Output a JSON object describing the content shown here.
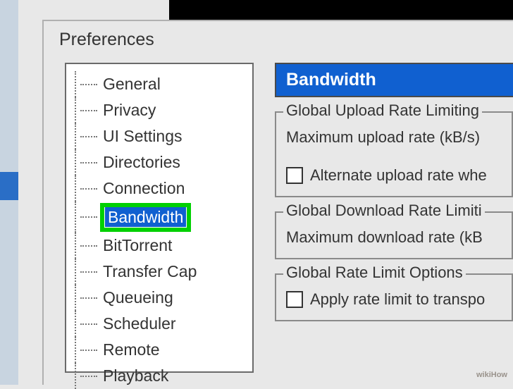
{
  "window": {
    "title": "Preferences"
  },
  "tree": {
    "items": [
      {
        "label": "General"
      },
      {
        "label": "Privacy"
      },
      {
        "label": "UI Settings"
      },
      {
        "label": "Directories"
      },
      {
        "label": "Connection"
      },
      {
        "label": "Bandwidth",
        "selected": true,
        "highlighted": true
      },
      {
        "label": "BitTorrent"
      },
      {
        "label": "Transfer Cap"
      },
      {
        "label": "Queueing"
      },
      {
        "label": "Scheduler"
      },
      {
        "label": "Remote"
      },
      {
        "label": "Playback"
      }
    ]
  },
  "panel": {
    "header": "Bandwidth",
    "groups": [
      {
        "legend": "Global Upload Rate Limiting",
        "rows": [
          {
            "text": "Maximum upload rate (kB/s)"
          },
          {
            "checkbox": true,
            "text": "Alternate upload rate whe"
          }
        ]
      },
      {
        "legend": "Global Download Rate Limiti",
        "rows": [
          {
            "text": "Maximum download rate (kB"
          }
        ]
      },
      {
        "legend": "Global Rate Limit Options",
        "rows": [
          {
            "checkbox": true,
            "text": "Apply rate limit to transpo"
          }
        ]
      }
    ]
  },
  "watermark": {
    "site": "wikiHow"
  }
}
